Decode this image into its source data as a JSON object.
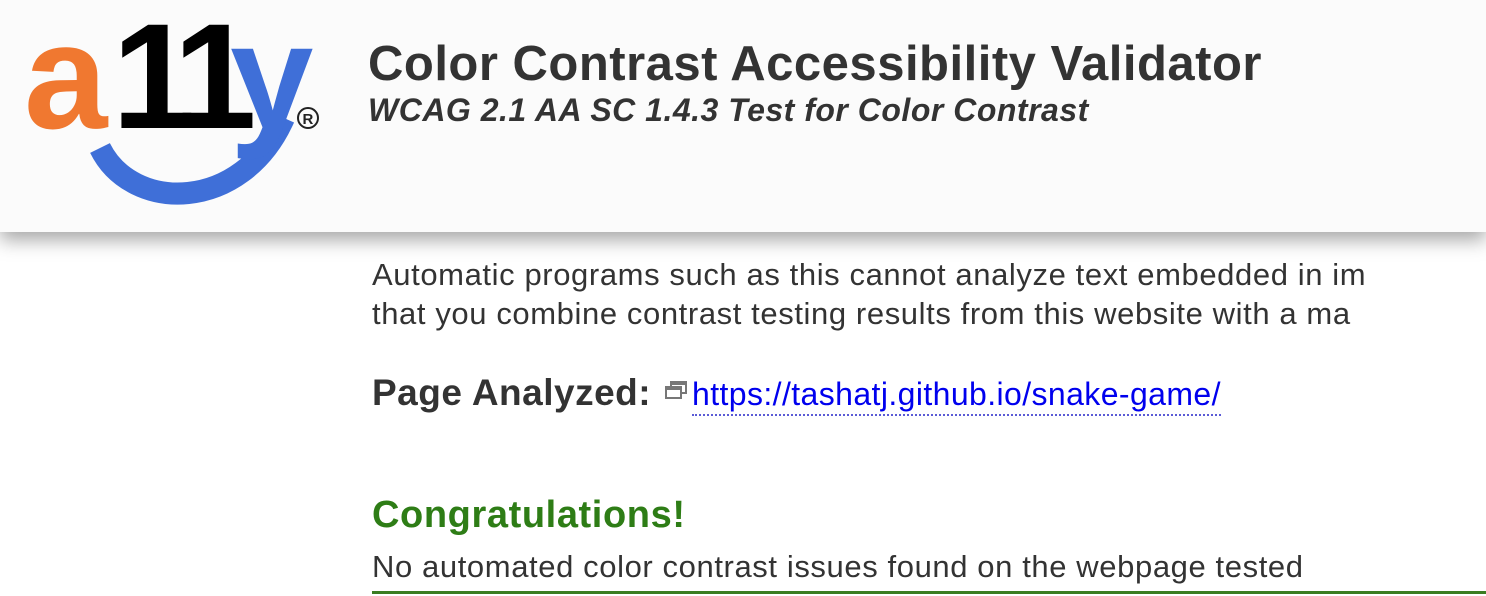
{
  "header": {
    "logo_text": "a11y®",
    "title": "Color Contrast Accessibility Validator",
    "subtitle": "WCAG 2.1 AA SC 1.4.3 Test for Color Contrast"
  },
  "intro": {
    "line1": "Automatic programs such as this cannot analyze text embedded in im",
    "line2": "that you combine contrast testing results from this website with a ma"
  },
  "analysis": {
    "label": "Page Analyzed:",
    "url": "https://tashatj.github.io/snake-game/",
    "link_icon": "external-window-icon"
  },
  "result": {
    "heading": "Congratulations!",
    "message": "No automated color contrast issues found on the webpage tested"
  },
  "colors": {
    "logo_orange": "#F07830",
    "logo_black": "#000000",
    "logo_blue": "#3F6FD8",
    "success_green": "#2E7D16",
    "link_blue": "#0000EE"
  }
}
